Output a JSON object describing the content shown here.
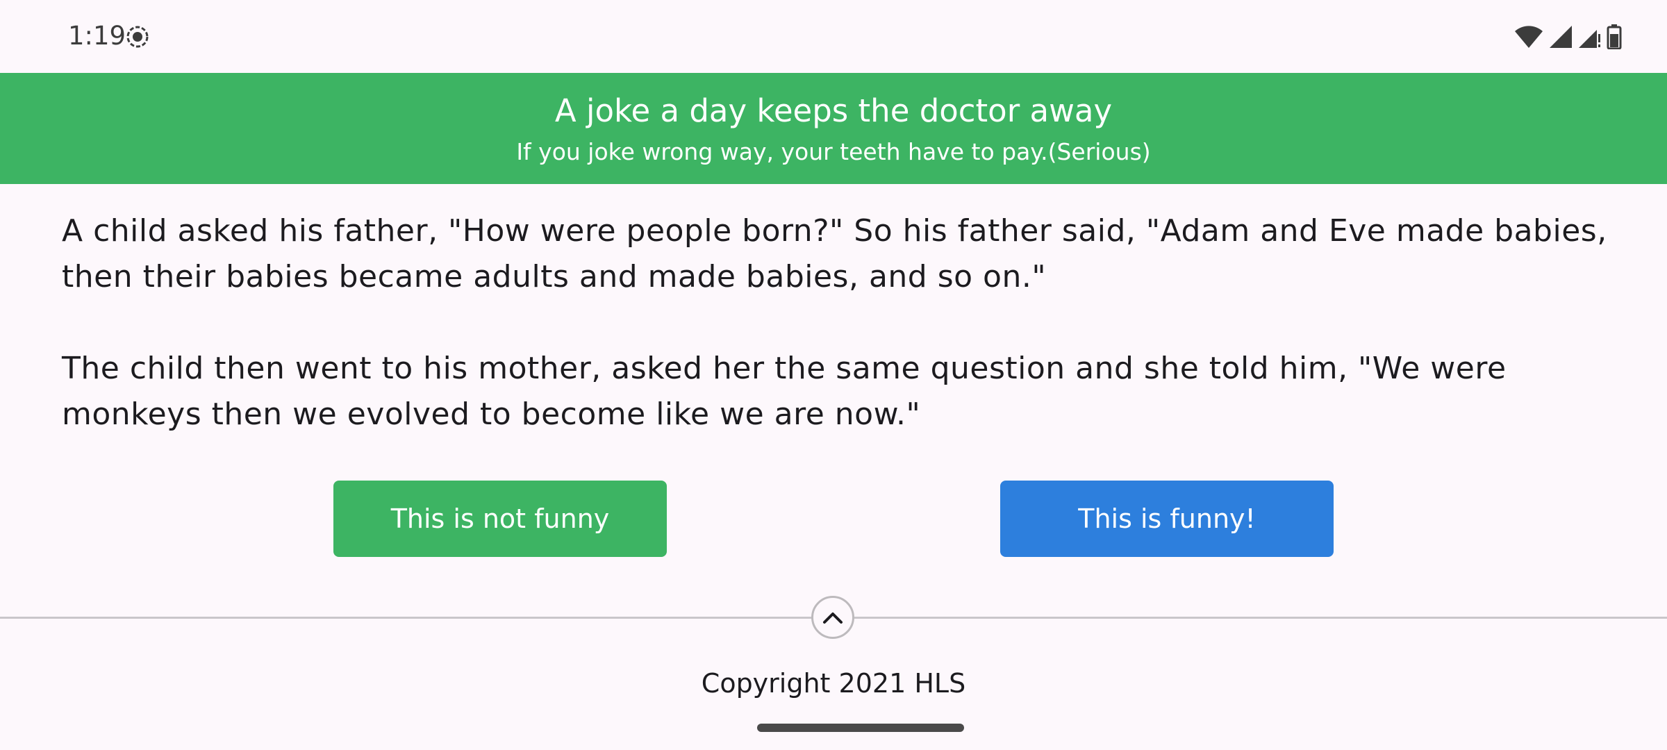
{
  "status_bar": {
    "time": "1:19",
    "icons": [
      "screen-record-icon",
      "wifi-icon",
      "signal-icon",
      "signal-weak-icon",
      "battery-icon"
    ]
  },
  "header": {
    "title": "A joke a day keeps the doctor away",
    "subtitle": "If you joke wrong way, your teeth have to pay.(Serious)",
    "background_color": "#3db463"
  },
  "joke": {
    "paragraphs": [
      "A child asked his father, \"How were people born?\" So his father said, \"Adam and Eve made babies, then their babies became adults and made babies, and so on.\"",
      "The child then went to his mother, asked her the same question and she told him, \"We were monkeys then we evolved to become like we are now.\""
    ]
  },
  "buttons": {
    "not_funny_label": "This is not funny",
    "funny_label": "This is funny!",
    "not_funny_color": "#3db463",
    "funny_color": "#2d7fdd"
  },
  "footer": {
    "scroll_up_icon": "chevron-up-icon",
    "copyright": "Copyright 2021 HLS"
  }
}
